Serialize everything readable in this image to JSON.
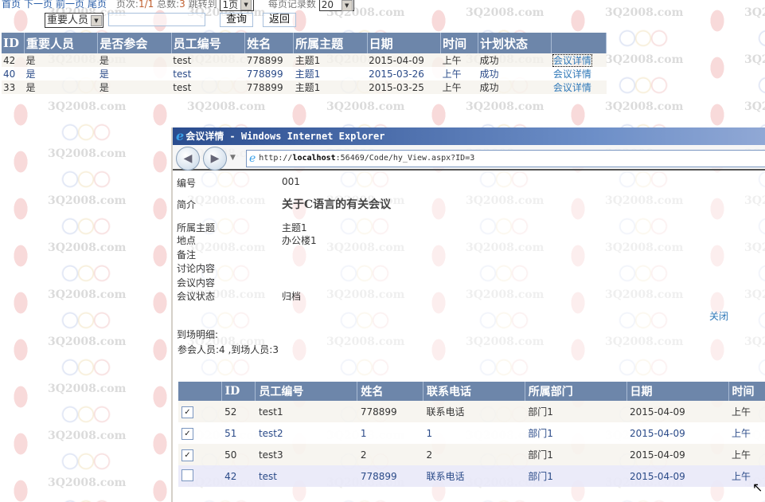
{
  "pager": {
    "first": "首页",
    "next": "下一页",
    "prev": "前一页",
    "last": "尾页",
    "page_label": "页次:",
    "page_value": "1/1",
    "total_label": "总数:",
    "total_value": "3",
    "jump_label": "跳转到",
    "jump_value": "1页",
    "per_page_label": "每页记录数",
    "per_page_value": "20"
  },
  "search": {
    "field_value": "重要人员",
    "input_value": "",
    "query_button": "查询",
    "back_button": "返回"
  },
  "main_table": {
    "headers": [
      "ID",
      "重要人员",
      "是否参会",
      "员工编号",
      "姓名",
      "所属主题",
      "日期",
      "时间",
      "计划状态",
      ""
    ],
    "rows": [
      [
        "42",
        "是",
        "是",
        "test",
        "778899",
        "主题1",
        "2015-04-09",
        "上午",
        "成功",
        "会议详情"
      ],
      [
        "40",
        "是",
        "是",
        "test",
        "778899",
        "主题1",
        "2015-03-26",
        "上午",
        "成功",
        "会议详情"
      ],
      [
        "33",
        "是",
        "是",
        "test",
        "778899",
        "主题1",
        "2015-03-25",
        "上午",
        "成功",
        "会议详情"
      ]
    ]
  },
  "popup": {
    "title": "会议详情 - Windows Internet Explorer",
    "address_prefix": "http://",
    "address_host": "localhost",
    "address_rest": ":56469/Code/hy_View.aspx?ID=3",
    "fields": [
      {
        "label": "编号",
        "value": "001"
      },
      {
        "label": "简介",
        "value": "关于C语言的有关会议"
      },
      {
        "label": "所属主题",
        "value": "主题1"
      },
      {
        "label": "地点",
        "value": "办公楼1"
      },
      {
        "label": "备注",
        "value": ""
      },
      {
        "label": "讨论内容",
        "value": ""
      },
      {
        "label": "会议内容",
        "value": ""
      },
      {
        "label": "会议状态",
        "value": "归档"
      }
    ],
    "close_link": "关闭",
    "attendance_title": "到场明细:",
    "attendance_summary": "参会人员:4 ,到场人员:3",
    "attendance_table": {
      "headers": [
        "",
        "ID",
        "员工编号",
        "姓名",
        "联系电话",
        "所属部门",
        "日期",
        "时间"
      ],
      "rows": [
        {
          "checked": true,
          "cells": [
            "52",
            "test1",
            "778899",
            "联系电话",
            "部门1",
            "2015-04-09",
            "上午"
          ]
        },
        {
          "checked": true,
          "cells": [
            "51",
            "test2",
            "1",
            "1",
            "部门1",
            "2015-04-09",
            "上午"
          ]
        },
        {
          "checked": true,
          "cells": [
            "50",
            "test3",
            "2",
            "2",
            "部门1",
            "2015-04-09",
            "上午"
          ]
        },
        {
          "checked": false,
          "cells": [
            "42",
            "test",
            "778899",
            "联系电话",
            "部门1",
            "2015-04-09",
            "上午"
          ]
        }
      ]
    }
  },
  "watermark": "3Q2008.com"
}
